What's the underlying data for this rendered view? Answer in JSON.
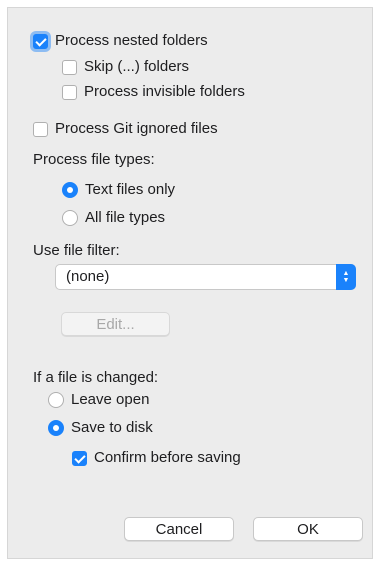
{
  "options": {
    "process_nested": {
      "label": "Process nested folders",
      "checked": true
    },
    "skip_folders": {
      "label": "Skip (...) folders",
      "checked": false
    },
    "process_invisible": {
      "label": "Process invisible folders",
      "checked": false
    },
    "process_git_ignored": {
      "label": "Process Git ignored files",
      "checked": false
    }
  },
  "file_types": {
    "heading": "Process file types:",
    "options": [
      {
        "label": "Text files only",
        "selected": true
      },
      {
        "label": "All file types",
        "selected": false
      }
    ]
  },
  "filter": {
    "heading": "Use file filter:",
    "value": "(none)",
    "edit_label": "Edit..."
  },
  "on_change": {
    "heading": "If a file is changed:",
    "options": [
      {
        "label": "Leave open",
        "selected": false
      },
      {
        "label": "Save to disk",
        "selected": true
      }
    ],
    "confirm": {
      "label": "Confirm before saving",
      "checked": true
    }
  },
  "buttons": {
    "cancel": "Cancel",
    "ok": "OK"
  },
  "colors": {
    "accent": "#1a82fb",
    "panel": "#ececec"
  }
}
